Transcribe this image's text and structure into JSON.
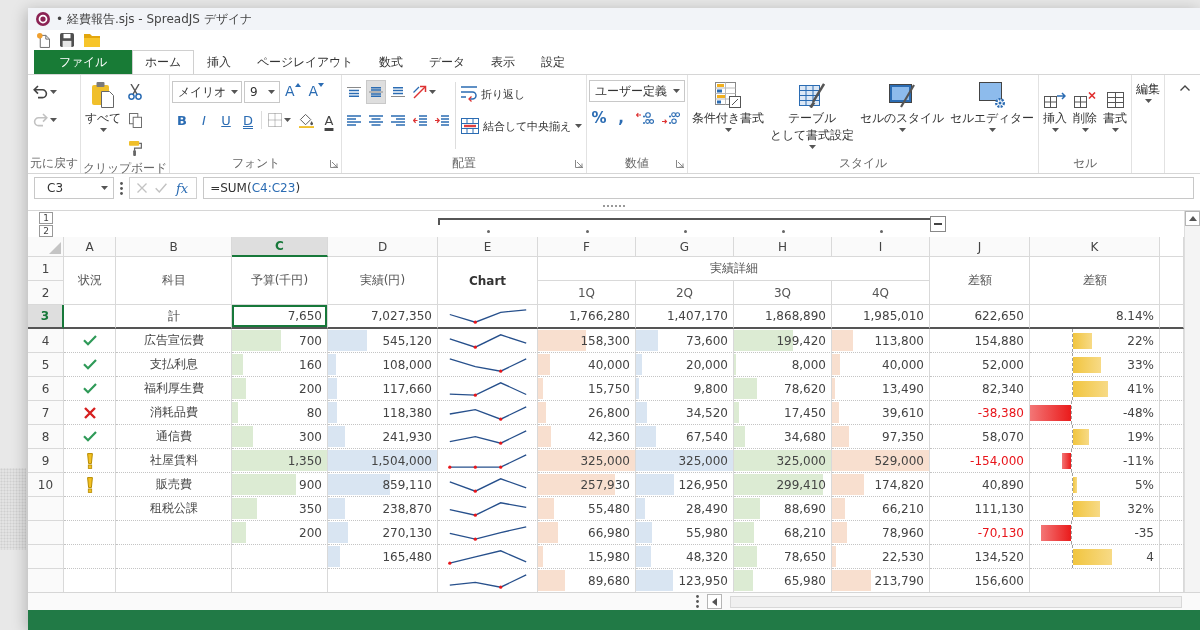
{
  "window": {
    "title": "• 経費報告.sjs - SpreadJS デザイナ"
  },
  "quick_access": [
    {
      "kind": "new"
    },
    {
      "kind": "save"
    },
    {
      "kind": "open"
    }
  ],
  "tabs": [
    {
      "label": "ファイル",
      "kind": "file",
      "selected": false
    },
    {
      "label": "ホーム",
      "kind": "tab",
      "selected": true
    },
    {
      "label": "挿入",
      "kind": "tab",
      "selected": false
    },
    {
      "label": "ページレイアウト",
      "kind": "tab",
      "selected": false
    },
    {
      "label": "数式",
      "kind": "tab",
      "selected": false
    },
    {
      "label": "データ",
      "kind": "tab",
      "selected": false
    },
    {
      "label": "表示",
      "kind": "tab",
      "selected": false
    },
    {
      "label": "設定",
      "kind": "tab",
      "selected": false
    }
  ],
  "ribbon": {
    "expanded": true,
    "groups": [
      {
        "kind": "undo",
        "label": "元に戻す",
        "launcher": false,
        "items": [
          {
            "kind": "undo",
            "disabled": false
          },
          {
            "kind": "redo",
            "disabled": true
          }
        ]
      },
      {
        "kind": "clipboard",
        "label": "クリップボード",
        "launcher": false,
        "paste": {
          "label": "すべて"
        },
        "items": [
          {
            "kind": "cut"
          },
          {
            "kind": "copy"
          },
          {
            "kind": "format-painter"
          }
        ]
      },
      {
        "kind": "font",
        "label": "フォント",
        "launcher": true,
        "font_name": "メイリオ",
        "font_size": "9",
        "size_buttons": [
          {
            "kind": "grow",
            "label": "A"
          },
          {
            "kind": "shrink",
            "label": "A"
          }
        ],
        "style_buttons": [
          {
            "kind": "bold",
            "label": "B"
          },
          {
            "kind": "italic",
            "label": "I"
          },
          {
            "kind": "underline",
            "label": "U"
          },
          {
            "kind": "double-underline",
            "label": "D"
          }
        ],
        "tools": [
          {
            "kind": "border"
          },
          {
            "kind": "fill"
          }
        ],
        "color_button": {
          "label": "A"
        }
      },
      {
        "kind": "alignment",
        "label": "配置",
        "launcher": true,
        "rows": [
          [
            {
              "kind": "top",
              "selected": false
            },
            {
              "kind": "middle",
              "selected": true
            },
            {
              "kind": "bottom",
              "selected": false
            },
            {
              "kind": "orientation",
              "selected": false
            }
          ],
          [
            {
              "kind": "left",
              "selected": false
            },
            {
              "kind": "center",
              "selected": false
            },
            {
              "kind": "right",
              "selected": false
            },
            {
              "kind": "outdent",
              "selected": false
            },
            {
              "kind": "indent",
              "selected": false
            }
          ]
        ],
        "wrap": {
          "label": "折り返し"
        },
        "merge": {
          "label": "結合して中央揃え"
        }
      },
      {
        "kind": "number",
        "label": "数値",
        "launcher": true,
        "format": "ユーザー定義",
        "buttons": [
          {
            "kind": "percent",
            "label": "%"
          },
          {
            "kind": "comma",
            "label": ","
          },
          {
            "kind": "increase-decimal"
          },
          {
            "kind": "decrease-decimal"
          }
        ]
      },
      {
        "kind": "styles",
        "label": "スタイル",
        "launcher": false,
        "items": [
          {
            "kind": "conditional",
            "lines": [
              "条件付き書式"
            ]
          },
          {
            "kind": "table",
            "lines": [
              "テーブル",
              "として書式設定"
            ]
          },
          {
            "kind": "cell-style",
            "lines": [
              "セルのスタイル"
            ]
          },
          {
            "kind": "cell-editor",
            "lines": [
              "セルエディター"
            ]
          }
        ]
      },
      {
        "kind": "cells",
        "label": "セル",
        "launcher": false,
        "items": [
          {
            "kind": "insert",
            "lines": [
              "挿入"
            ]
          },
          {
            "kind": "delete",
            "lines": [
              "削除"
            ]
          },
          {
            "kind": "format",
            "lines": [
              "書式"
            ]
          }
        ]
      },
      {
        "kind": "editing",
        "launcher": false,
        "items": [
          {
            "kind": "editing",
            "lines": [
              "編集"
            ]
          }
        ]
      }
    ]
  },
  "formula_bar": {
    "name_box": "C3",
    "buttons": [
      {
        "kind": "cancel",
        "disabled": true
      },
      {
        "kind": "enter",
        "disabled": true
      }
    ],
    "function_label": "fx",
    "formula": [
      {
        "kind": "plain",
        "text": "=SUM("
      },
      {
        "kind": "reference",
        "text": "C4:C23"
      },
      {
        "kind": "plain",
        "text": ")"
      }
    ]
  },
  "sheet": {
    "outline_levels": [
      {
        "label": "1"
      },
      {
        "label": "2"
      }
    ],
    "group_expanded": true,
    "columns": [
      {
        "letter": "A",
        "selected": false,
        "grouped": false
      },
      {
        "letter": "B",
        "selected": false,
        "grouped": false
      },
      {
        "letter": "C",
        "selected": true,
        "grouped": false
      },
      {
        "letter": "D",
        "selected": false,
        "grouped": false
      },
      {
        "letter": "E",
        "selected": false,
        "grouped": true
      },
      {
        "letter": "F",
        "selected": false,
        "grouped": true
      },
      {
        "letter": "G",
        "selected": false,
        "grouped": true
      },
      {
        "letter": "H",
        "selected": false,
        "grouped": true
      },
      {
        "letter": "I",
        "selected": false,
        "grouped": true
      },
      {
        "letter": "J",
        "selected": false,
        "grouped": false
      },
      {
        "letter": "K",
        "selected": false,
        "grouped": false
      }
    ],
    "header_rows": [
      {
        "number": "1",
        "selected": false
      },
      {
        "number": "2",
        "selected": false
      }
    ],
    "header_cells": [
      {
        "text": "状況",
        "bold": false
      },
      {
        "text": "科目",
        "bold": false
      },
      {
        "text": "予算(千円)",
        "bold": false
      },
      {
        "text": "実績(円)",
        "bold": false
      },
      {
        "text": "Chart",
        "bold": true
      },
      {
        "text": "実績詳細",
        "bold": false,
        "children": [
          {
            "text": "1Q"
          },
          {
            "text": "2Q"
          },
          {
            "text": "3Q"
          },
          {
            "text": "4Q"
          }
        ]
      },
      {
        "text": "差額",
        "bold": false
      },
      {
        "text": "差額",
        "bold": false
      }
    ],
    "rows": [
      {
        "kind": "total",
        "number": "3",
        "selected": true,
        "item": "計",
        "budget": {
          "text": "7,650"
        },
        "actual": {
          "text": "7,027,350"
        },
        "q1": {
          "text": "1,766,280"
        },
        "q2": {
          "text": "1,407,170"
        },
        "q3": {
          "text": "1,868,890"
        },
        "q4": {
          "text": "1,985,010"
        },
        "difference": {
          "text": "622,650",
          "negative": false
        },
        "rate": {
          "text": "8.14%"
        }
      },
      {
        "kind": "item",
        "number": "4",
        "selected": false,
        "status": {
          "kind": "ok"
        },
        "item": "広告宣伝費",
        "budget": {
          "text": "700",
          "level": 0.52
        },
        "actual": {
          "text": "545,120",
          "level": 0.36
        },
        "q1": {
          "text": "158,300",
          "level": 0.49
        },
        "q2": {
          "text": "73,600",
          "level": 0.23
        },
        "q3": {
          "text": "199,420",
          "level": 0.61
        },
        "q4": {
          "text": "113,800",
          "level": 0.22
        },
        "difference": {
          "text": "154,880",
          "negative": false
        },
        "rate": {
          "text": "22%",
          "level": 0.46,
          "negative": false
        }
      },
      {
        "kind": "item",
        "number": "5",
        "selected": false,
        "status": {
          "kind": "ok"
        },
        "item": "支払利息",
        "budget": {
          "text": "160",
          "level": 0.12
        },
        "actual": {
          "text": "108,000",
          "level": 0.07
        },
        "q1": {
          "text": "40,000",
          "level": 0.12
        },
        "q2": {
          "text": "20,000",
          "level": 0.06
        },
        "q3": {
          "text": "8,000",
          "level": 0.02
        },
        "q4": {
          "text": "40,000",
          "level": 0.08
        },
        "difference": {
          "text": "52,000",
          "negative": false
        },
        "rate": {
          "text": "33%",
          "level": 0.69,
          "negative": false
        }
      },
      {
        "kind": "item",
        "number": "6",
        "selected": false,
        "status": {
          "kind": "ok"
        },
        "item": "福利厚生費",
        "budget": {
          "text": "200",
          "level": 0.15
        },
        "actual": {
          "text": "117,660",
          "level": 0.08
        },
        "q1": {
          "text": "15,750",
          "level": 0.05
        },
        "q2": {
          "text": "9,800",
          "level": 0.03
        },
        "q3": {
          "text": "78,620",
          "level": 0.24
        },
        "q4": {
          "text": "13,490",
          "level": 0.03
        },
        "difference": {
          "text": "82,340",
          "negative": false
        },
        "rate": {
          "text": "41%",
          "level": 0.85,
          "negative": false
        }
      },
      {
        "kind": "item",
        "number": "7",
        "selected": false,
        "status": {
          "kind": "ng"
        },
        "item": "消耗品費",
        "budget": {
          "text": "80",
          "level": 0.06
        },
        "actual": {
          "text": "118,380",
          "level": 0.08
        },
        "q1": {
          "text": "26,800",
          "level": 0.08
        },
        "q2": {
          "text": "34,520",
          "level": 0.11
        },
        "q3": {
          "text": "17,450",
          "level": 0.05
        },
        "q4": {
          "text": "39,610",
          "level": 0.07
        },
        "difference": {
          "text": "-38,380",
          "negative": true
        },
        "rate": {
          "text": "-48%",
          "level": 1,
          "negative": true
        }
      },
      {
        "kind": "item",
        "number": "8",
        "selected": false,
        "status": {
          "kind": "ok"
        },
        "item": "通信費",
        "budget": {
          "text": "300",
          "level": 0.22
        },
        "actual": {
          "text": "241,930",
          "level": 0.16
        },
        "q1": {
          "text": "42,360",
          "level": 0.13
        },
        "q2": {
          "text": "67,540",
          "level": 0.21
        },
        "q3": {
          "text": "34,680",
          "level": 0.11
        },
        "q4": {
          "text": "97,350",
          "level": 0.18
        },
        "difference": {
          "text": "58,070",
          "negative": false
        },
        "rate": {
          "text": "19%",
          "level": 0.4,
          "negative": false
        }
      },
      {
        "kind": "item",
        "number": "9",
        "selected": false,
        "status": {
          "kind": "warn"
        },
        "item": "社屋賃料",
        "budget": {
          "text": "1,350",
          "level": 1
        },
        "actual": {
          "text": "1,504,000",
          "level": 1
        },
        "q1": {
          "text": "325,000",
          "level": 1
        },
        "q2": {
          "text": "325,000",
          "level": 1
        },
        "q3": {
          "text": "325,000",
          "level": 1
        },
        "q4": {
          "text": "529,000",
          "level": 1
        },
        "difference": {
          "text": "-154,000",
          "negative": true
        },
        "rate": {
          "text": "-11%",
          "level": 0.23,
          "negative": true
        }
      },
      {
        "kind": "item",
        "number": "10",
        "selected": false,
        "status": {
          "kind": "warn"
        },
        "item": "販売費",
        "budget": {
          "text": "900",
          "level": 0.67
        },
        "actual": {
          "text": "859,110",
          "level": 0.57
        },
        "q1": {
          "text": "257,930",
          "level": 0.79
        },
        "q2": {
          "text": "126,950",
          "level": 0.39
        },
        "q3": {
          "text": "299,410",
          "level": 0.92
        },
        "q4": {
          "text": "174,820",
          "level": 0.33
        },
        "difference": {
          "text": "40,890",
          "negative": false
        },
        "rate": {
          "text": "5%",
          "level": 0.1,
          "negative": false
        }
      },
      {
        "kind": "item",
        "selected": false,
        "item": "租税公課",
        "budget": {
          "text": "350",
          "level": 0.26
        },
        "actual": {
          "text": "238,870",
          "level": 0.16
        },
        "q1": {
          "text": "55,480",
          "level": 0.17
        },
        "q2": {
          "text": "28,490",
          "level": 0.09
        },
        "q3": {
          "text": "88,690",
          "level": 0.27
        },
        "q4": {
          "text": "66,210",
          "level": 0.13
        },
        "difference": {
          "text": "111,130",
          "negative": false
        },
        "rate": {
          "text": "32%",
          "level": 0.67,
          "negative": false
        }
      },
      {
        "kind": "item",
        "selected": false,
        "budget": {
          "text": "200",
          "level": 0.15
        },
        "actual": {
          "text": "270,130",
          "level": 0.18
        },
        "q1": {
          "text": "66,980",
          "level": 0.21
        },
        "q2": {
          "text": "55,980",
          "level": 0.17
        },
        "q3": {
          "text": "68,210",
          "level": 0.21
        },
        "q4": {
          "text": "78,960",
          "level": 0.15
        },
        "difference": {
          "text": "-70,130",
          "negative": true
        },
        "rate": {
          "text": "-35",
          "level": 0.73,
          "negative": true
        }
      },
      {
        "kind": "item",
        "selected": false,
        "actual": {
          "text": "165,480",
          "level": 0.11
        },
        "q1": {
          "text": "15,980",
          "level": 0.05
        },
        "q2": {
          "text": "48,320",
          "level": 0.15
        },
        "q3": {
          "text": "78,650",
          "level": 0.24
        },
        "q4": {
          "text": "22,530",
          "level": 0.04
        },
        "difference": {
          "text": "134,520",
          "negative": false
        },
        "rate": {
          "text": "4",
          "level": 0.94,
          "negative": false
        }
      },
      {
        "kind": "item",
        "selected": false,
        "q1": {
          "text": "89,680",
          "level": 0.28
        },
        "q2": {
          "text": "123,950",
          "level": 0.38
        },
        "q3": {
          "text": "65,980",
          "level": 0.2
        },
        "q4": {
          "text": "213,790",
          "level": 0.4
        },
        "difference": {
          "text": "156,600",
          "negative": false
        }
      }
    ]
  }
}
